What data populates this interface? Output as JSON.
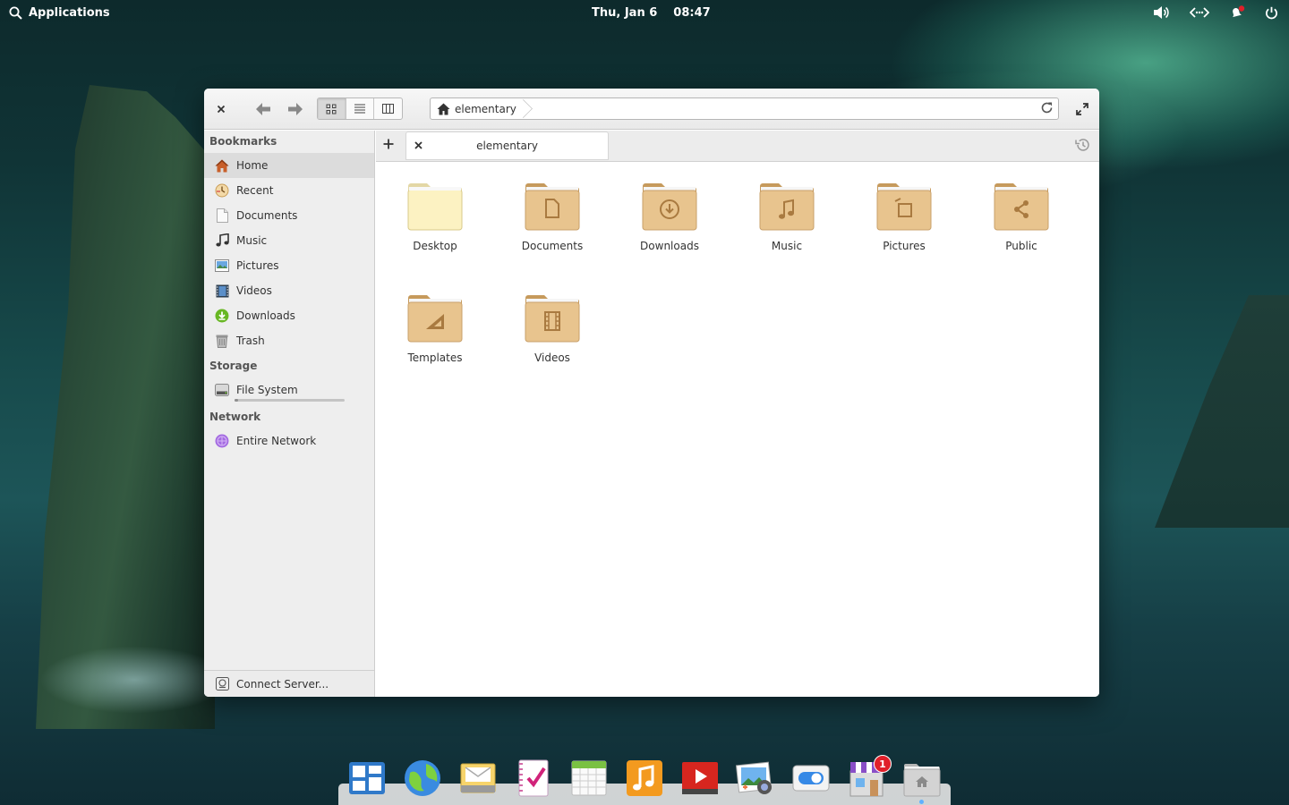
{
  "panel": {
    "applications_label": "Applications",
    "date": "Thu, Jan 6",
    "time": "08:47"
  },
  "window": {
    "view_modes": [
      "icon-view",
      "list-view",
      "column-view"
    ],
    "active_view": "icon-view",
    "location": "elementary",
    "tab_label": "elementary"
  },
  "sidebar": {
    "bookmarks_header": "Bookmarks",
    "bookmarks": [
      {
        "label": "Home",
        "icon": "home-icon",
        "selected": true
      },
      {
        "label": "Recent",
        "icon": "recent-icon"
      },
      {
        "label": "Documents",
        "icon": "documents-icon"
      },
      {
        "label": "Music",
        "icon": "music-icon"
      },
      {
        "label": "Pictures",
        "icon": "pictures-icon"
      },
      {
        "label": "Videos",
        "icon": "videos-icon"
      },
      {
        "label": "Downloads",
        "icon": "downloads-icon"
      },
      {
        "label": "Trash",
        "icon": "trash-icon"
      }
    ],
    "storage_header": "Storage",
    "storage": [
      {
        "label": "File System",
        "icon": "drive-icon",
        "usage_fraction": 0.03
      }
    ],
    "network_header": "Network",
    "network": [
      {
        "label": "Entire Network",
        "icon": "network-icon"
      }
    ],
    "connect_label": "Connect Server..."
  },
  "folders": [
    {
      "label": "Desktop",
      "icon": "desktop-folder-icon"
    },
    {
      "label": "Documents",
      "icon": "documents-folder-icon"
    },
    {
      "label": "Downloads",
      "icon": "downloads-folder-icon"
    },
    {
      "label": "Music",
      "icon": "music-folder-icon"
    },
    {
      "label": "Pictures",
      "icon": "pictures-folder-icon"
    },
    {
      "label": "Public",
      "icon": "public-folder-icon"
    },
    {
      "label": "Templates",
      "icon": "templates-folder-icon"
    },
    {
      "label": "Videos",
      "icon": "videos-folder-icon"
    }
  ],
  "dock": {
    "apps": [
      "multitasking-view-icon",
      "web-browser-icon",
      "mail-icon",
      "tasks-icon",
      "calendar-icon",
      "music-app-icon",
      "videos-app-icon",
      "photos-app-icon",
      "settings-app-icon",
      "appcenter-icon",
      "files-app-icon"
    ],
    "appcenter_badge": "1"
  },
  "colors": {
    "folder": "#e8c48e",
    "folder_dark": "#c69a5c",
    "accent": "#3689e6",
    "badge": "#e0202a"
  }
}
